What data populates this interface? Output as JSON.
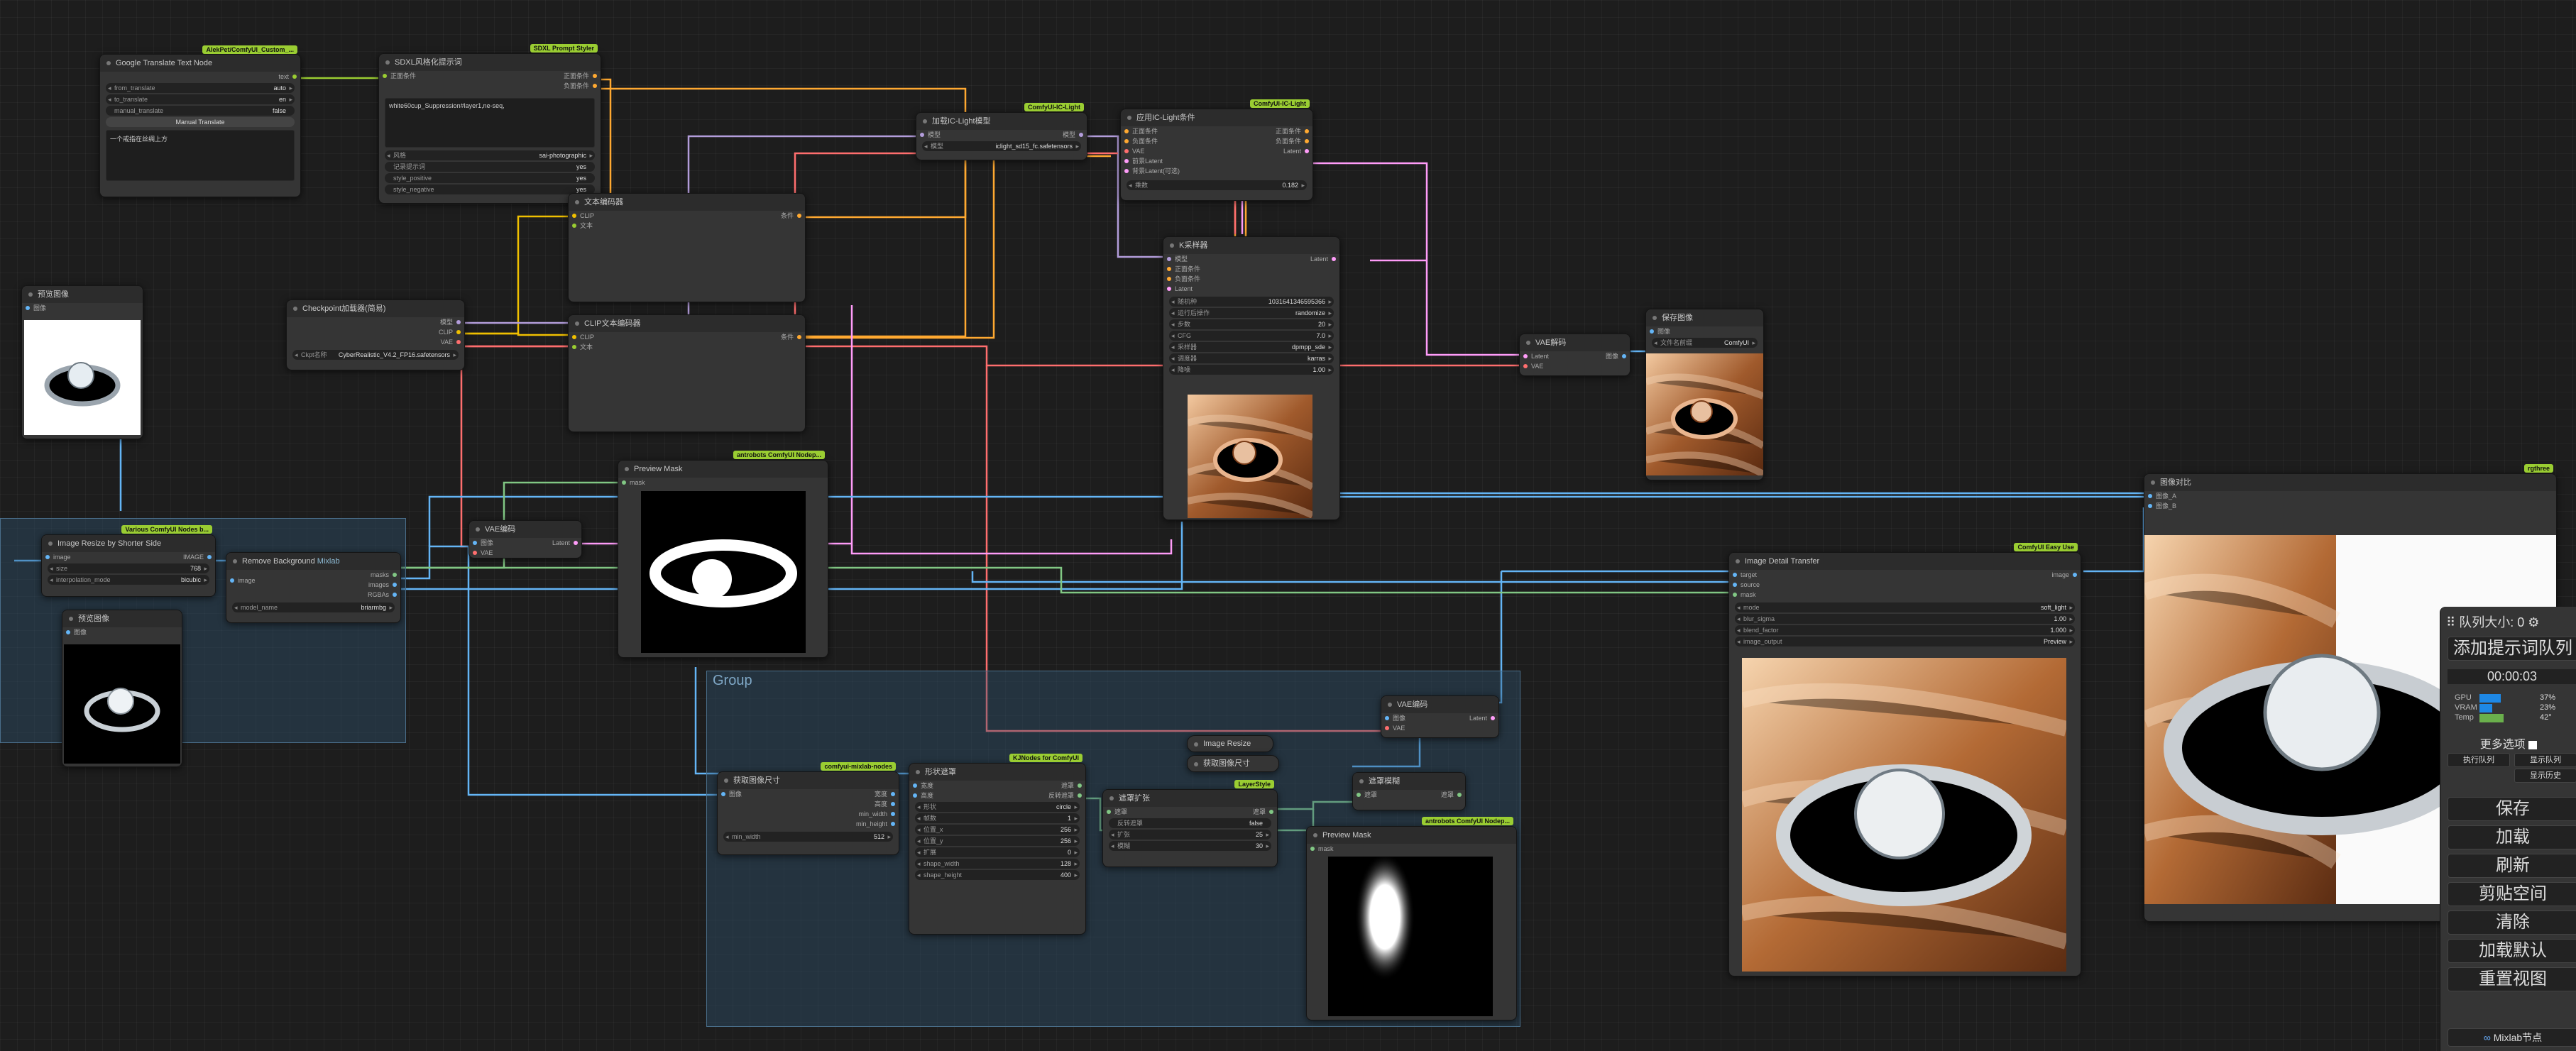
{
  "colors": {
    "clip": "#f0c000",
    "conditioning": "#ffa931",
    "model": "#b39ddb",
    "vae": "#ff6e6e",
    "latent": "#ff9cf9",
    "image": "#64b5f6",
    "mask": "#81c784",
    "badge": "#9acd32"
  },
  "group_labels": {
    "group": "Group"
  },
  "nodes": {
    "translate": {
      "title": "Google Translate Text Node",
      "badge": "AlekPet/ComfyUI_Custom_...",
      "out_text": "text",
      "w_from": [
        "from_translate",
        "auto"
      ],
      "w_to": [
        "to_translate",
        "en"
      ],
      "w_manual": [
        "manual_translate",
        "false"
      ],
      "btn": "Manual Translate",
      "text": "一个戒指在丝绸上方"
    },
    "styler": {
      "title": "SDXL风格化提示词",
      "badge": "SDXL Prompt Styler",
      "in1": "正面条件",
      "out1": "正面条件",
      "out2": "负面条件",
      "text": "white60cup_Suppression#layer1,ne-seq,",
      "w_style": [
        "风格",
        "sai-photographic"
      ],
      "w_log": [
        "记录提示词",
        "yes"
      ],
      "w_pos": [
        "style_positive",
        "yes"
      ],
      "w_neg": [
        "style_negative",
        "yes"
      ]
    },
    "loadicl": {
      "title": "加载IC-Light模型",
      "badge": "ComfyUI-IC-Light",
      "in1": "模型",
      "out1": "模型",
      "w_model": [
        "模型",
        "iclight_sd15_fc.safetensors"
      ]
    },
    "applyicl": {
      "title": "应用IC-Light条件",
      "badge": "ComfyUI-IC-Light",
      "in1": "正面条件",
      "in2": "负面条件",
      "in3": "VAE",
      "in4": "前景Latent",
      "in5": "背景Latent(可选)",
      "out1": "正面条件",
      "out2": "负面条件",
      "out3": "Latent",
      "w_mult": [
        "乘数",
        "0.182"
      ]
    },
    "textenc1": {
      "title": "文本编码器",
      "in1": "CLIP",
      "in2": "文本",
      "out1": "条件"
    },
    "checkpoint": {
      "title": "Checkpoint加载器(简易)",
      "out1": "模型",
      "out2": "CLIP",
      "out3": "VAE",
      "w_ckpt": [
        "Ckpt名称",
        "CyberRealistic_V4.2_FP16.safetensors"
      ]
    },
    "textenc2": {
      "title": "CLIP文本编码器",
      "in1": "CLIP",
      "in2": "文本",
      "out1": "条件"
    },
    "ksampler": {
      "title": "K采样器",
      "in1": "模型",
      "in2": "正面条件",
      "in3": "负面条件",
      "in4": "Latent",
      "out1": "Latent",
      "w_seed": [
        "随机种",
        "1031641346595366"
      ],
      "w_ctrl": [
        "运行后操作",
        "randomize"
      ],
      "w_steps": [
        "步数",
        "20"
      ],
      "w_cfg": [
        "CFG",
        "7.0"
      ],
      "w_sampler": [
        "采样器",
        "dpmpp_sde"
      ],
      "w_sched": [
        "调度器",
        "karras"
      ],
      "w_denoise": [
        "降噪",
        "1.00"
      ]
    },
    "vaedec1": {
      "title": "VAE解码",
      "in1": "Latent",
      "in2": "VAE",
      "out1": "图像"
    },
    "save": {
      "title": "保存图像",
      "in1": "图像",
      "w_prefix": [
        "文件名前缀",
        "ComfyUI"
      ]
    },
    "preview1": {
      "title": "预览图像",
      "in1": "图像"
    },
    "resize": {
      "title": "Image Resize by Shorter Side",
      "badge": "Various ComfyUI Nodes b...",
      "in1": "image",
      "out1": "IMAGE",
      "w_size": [
        "size",
        "768"
      ],
      "w_interp": [
        "interpolation_mode",
        "bicubic"
      ]
    },
    "rmbg": {
      "title": "Remove Background",
      "badge2": "Mixlab",
      "in1": "image",
      "out1": "masks",
      "out2": "images",
      "out3": "RGBAs",
      "w_model": [
        "model_name",
        "briarmbg"
      ]
    },
    "preview2": {
      "title": "预览图像",
      "in1": "图像"
    },
    "vaeenc": {
      "title": "VAE编码",
      "in1": "图像",
      "in2": "VAE",
      "out1": "Latent"
    },
    "previewmask1": {
      "title": "Preview Mask",
      "badge": "antrobots ComfyUI Nodep...",
      "in1": "mask"
    },
    "compare": {
      "title": "图像对比",
      "badge": "rgthree",
      "in1": "图像_A",
      "in2": "图像_B"
    },
    "detail": {
      "title": "Image Detail Transfer",
      "badge": "ComfyUI Easy Use",
      "in1": "target",
      "in2": "source",
      "in3": "mask",
      "out1": "image",
      "w_mode": [
        "mode",
        "soft_light"
      ],
      "w_blur": [
        "blur_sigma",
        "1.00"
      ],
      "w_blend": [
        "blend_factor",
        "1.000"
      ],
      "w_out": [
        "image_output",
        "Preview"
      ]
    },
    "vaeenc2": {
      "title": "VAE编码",
      "in1": "图像",
      "in2": "VAE",
      "out1": "Latent"
    },
    "imgresize": {
      "title": "Image Resize"
    },
    "getsize1": {
      "title": "获取图像尺寸"
    },
    "getsize2": {
      "title": "获取图像尺寸",
      "badge": "comfyui-mixlab-nodes",
      "in1": "图像",
      "out1": "宽度",
      "out2": "高度",
      "out3": "min_width",
      "out4": "min_height",
      "w_min": [
        "min_width",
        "512"
      ]
    },
    "shape": {
      "title": "形状遮罩",
      "badge": "KJNodes for ComfyUI",
      "in1": "宽度",
      "in2": "高度",
      "out1": "遮罩",
      "out2": "反转遮罩",
      "w_shape": [
        "形状",
        "circle"
      ],
      "w_frames": [
        "帧数",
        "1"
      ],
      "w_x": [
        "位置_x",
        "256"
      ],
      "w_y": [
        "位置_y",
        "256"
      ],
      "w_grow": [
        "扩展",
        "0"
      ],
      "w_sw": [
        "shape_width",
        "128"
      ],
      "w_sh": [
        "shape_height",
        "400"
      ]
    },
    "maskgrow": {
      "title": "遮罩扩张",
      "badge": "LayerStyle",
      "in1": "遮罩",
      "out1": "遮罩",
      "w_invert": [
        "反转遮罩",
        "false"
      ],
      "w_grow": [
        "扩张",
        "25"
      ],
      "w_blur": [
        "模糊",
        "30"
      ]
    },
    "blur": {
      "title": "遮罩模糊",
      "in1": "遮罩",
      "out1": "遮罩"
    },
    "previewmask2": {
      "title": "Preview Mask",
      "badge": "antrobots ComfyUI Nodep...",
      "in1": "mask"
    }
  },
  "sidebar": {
    "queue_label": "队列大小: 0",
    "add_prompt": "添加提示词队列",
    "timer": "00:00:03",
    "gpu_label": "GPU",
    "gpu_pct": "37%",
    "gpu_value": 0.37,
    "vram_label": "VRAM",
    "vram_pct": "23%",
    "vram_value": 0.23,
    "temp_label": "Temp",
    "temp_val": "42°",
    "temp_value": 0.42,
    "more_options": "更多选项",
    "queue_btn": "执行队列",
    "history_btn": "显示队列",
    "history_view": "显示历史",
    "save": "保存",
    "load": "加载",
    "refresh": "刷新",
    "clipspace": "剪贴空间",
    "clear": "清除",
    "load_default": "加载默认",
    "reset_view": "重置视图",
    "mixlab": "Mixlab节点"
  }
}
